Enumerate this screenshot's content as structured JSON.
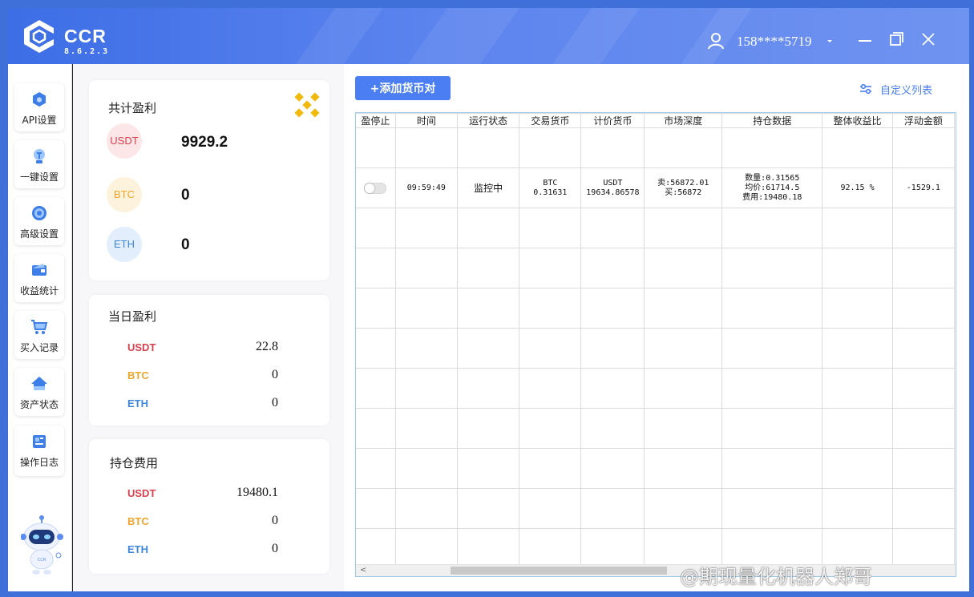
{
  "app": {
    "title": "CCR",
    "version": "8.6.2.3"
  },
  "user": {
    "phone": "158****5719"
  },
  "nav": {
    "items": [
      {
        "label": "API设置",
        "icon": "api-cube-icon"
      },
      {
        "label": "一键设置",
        "icon": "lightbulb-icon"
      },
      {
        "label": "高级设置",
        "icon": "gear-icon"
      },
      {
        "label": "收益统计",
        "icon": "wallet-card-icon"
      },
      {
        "label": "买入记录",
        "icon": "cart-icon"
      },
      {
        "label": "资产状态",
        "icon": "home-icon"
      },
      {
        "label": "操作日志",
        "icon": "log-icon"
      }
    ]
  },
  "summary": {
    "title": "共计盈利",
    "coins": [
      {
        "name": "USDT",
        "value": "9929.2"
      },
      {
        "name": "BTC",
        "value": "0"
      },
      {
        "name": "ETH",
        "value": "0"
      }
    ]
  },
  "daily": {
    "title": "当日盈利",
    "rows": [
      {
        "coin": "USDT",
        "value": "22.8"
      },
      {
        "coin": "BTC",
        "value": "0"
      },
      {
        "coin": "ETH",
        "value": "0"
      }
    ]
  },
  "holding_fee": {
    "title": "持仓费用",
    "rows": [
      {
        "coin": "USDT",
        "value": "19480.1"
      },
      {
        "coin": "BTC",
        "value": "0"
      },
      {
        "coin": "ETH",
        "value": "0"
      }
    ]
  },
  "toolbar": {
    "add_label": "+添加货币对",
    "custom_label": "自定义列表"
  },
  "table": {
    "headers": [
      "盈停止",
      "时间",
      "运行状态",
      "交易货币",
      "计价货币",
      "市场深度",
      "持仓数据",
      "整体收益比",
      "浮动金额"
    ],
    "row": {
      "time": "09:59:49",
      "status": "监控中",
      "trade_coin": "BTC",
      "trade_amount": "0.31631",
      "quote_coin": "USDT",
      "quote_amount": "19634.86578",
      "depth_sell": "卖:56872.01",
      "depth_buy": "买:56872",
      "pos_qty": "数量:0.31565",
      "pos_avg": "均价:61714.5",
      "pos_fee": "费用:19480.18",
      "ratio": "92.15 %",
      "float": "-1529.1"
    }
  },
  "watermark": "@期现量化机器人郑哥",
  "colors": {
    "header": "#4a7ef2",
    "usdt": "#d9414f",
    "btc": "#f0a52a",
    "eth": "#3f87d9"
  }
}
